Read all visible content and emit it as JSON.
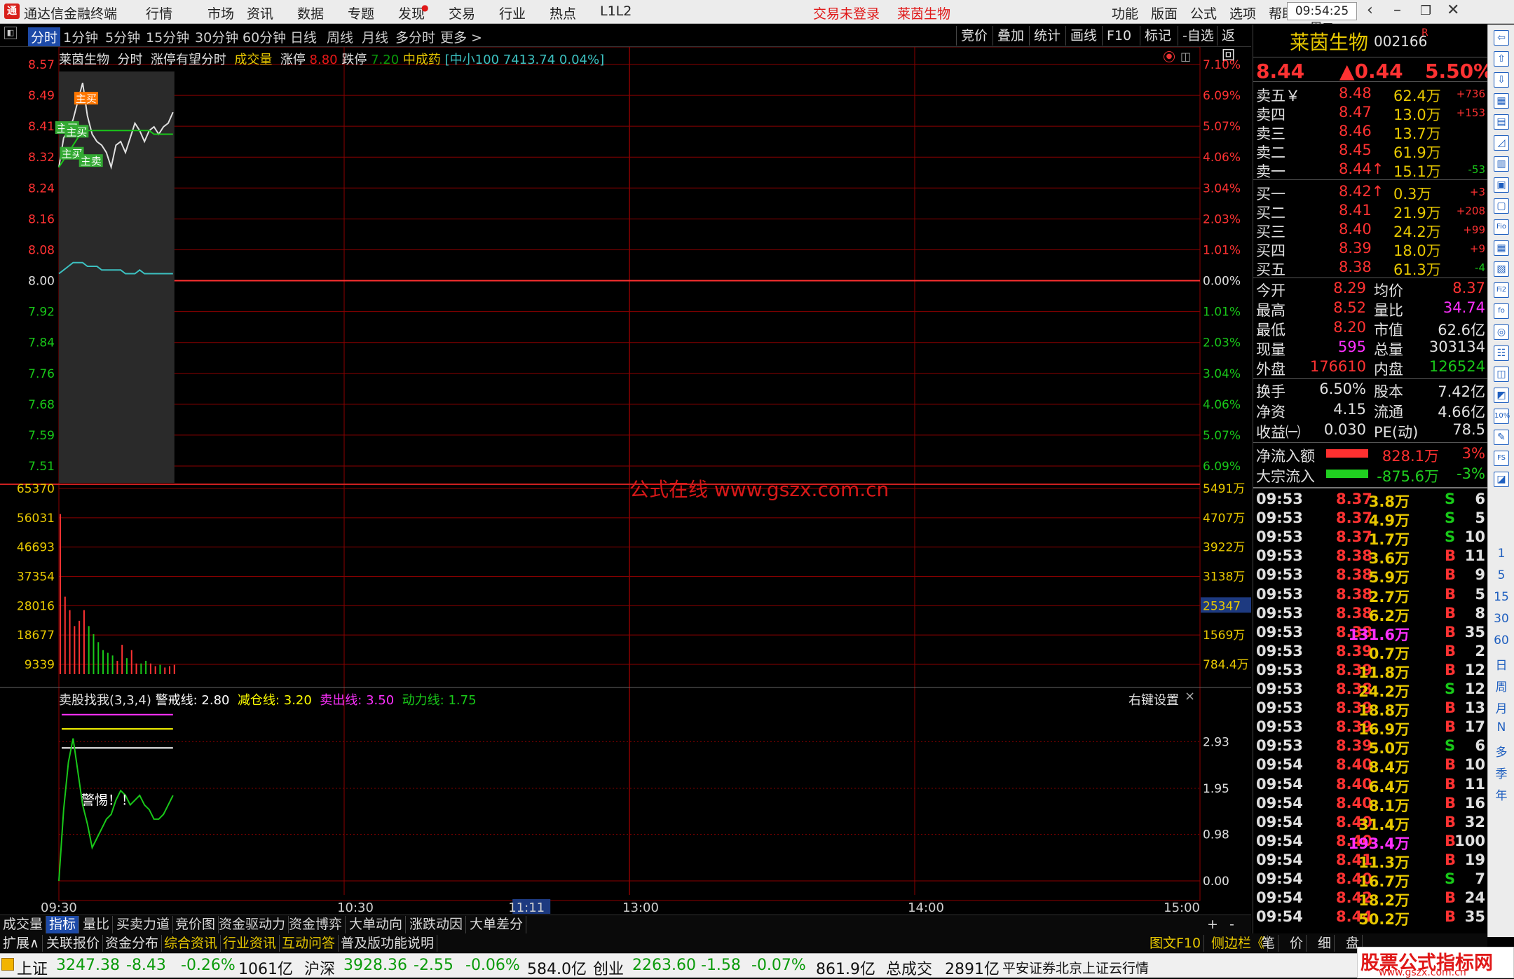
{
  "app": {
    "title": "通达信金融终端",
    "menu": [
      "行情",
      "市场",
      "资讯",
      "数据",
      "专题",
      "发现",
      "交易",
      "行业",
      "热点",
      "L1L2"
    ],
    "status_left": "交易未登录",
    "status_stock": "莱茵生物",
    "menu_right": [
      "功能",
      "版面",
      "公式",
      "选项",
      "帮助"
    ],
    "clock": "09:54:25",
    "weekday": "周二"
  },
  "periods": [
    "分时",
    "1分钟",
    "5分钟",
    "15分钟",
    "30分钟",
    "60分钟",
    "日线",
    "周线",
    "月线",
    "多分时",
    "更多 >"
  ],
  "active_period": "分时",
  "right_tools": [
    "竞价",
    "叠加",
    "统计",
    "画线",
    "F10",
    "标记",
    "-自选",
    "返回"
  ],
  "chart_header": {
    "name": "莱茵生物",
    "mode": "分时",
    "formula": "涨停有望分时",
    "vol_label": "成交量",
    "limit_up_label": "涨停",
    "limit_up": "8.80",
    "limit_down_label": "跌停",
    "limit_down": "7.20",
    "industry": "中成药",
    "index": "[中小100 7413.74 0.04%]"
  },
  "watermark": "公式在线  www.gszx.com.cn",
  "price_axis": {
    "left": [
      "8.57",
      "8.49",
      "8.41",
      "8.32",
      "8.24",
      "8.16",
      "8.08",
      "8.00",
      "7.92",
      "7.84",
      "7.76",
      "7.68",
      "7.59",
      "7.51"
    ],
    "right": [
      "7.10%",
      "6.09%",
      "5.07%",
      "4.06%",
      "3.04%",
      "2.03%",
      "1.01%",
      "0.00%",
      "1.01%",
      "2.03%",
      "3.04%",
      "4.06%",
      "5.07%",
      "6.09%"
    ]
  },
  "volume_axis": {
    "left": [
      "65370",
      "56031",
      "46693",
      "37354",
      "28016",
      "18677",
      "9339"
    ],
    "right": [
      "5491万",
      "4707万",
      "3922万",
      "3138万",
      "25347",
      "1569万",
      "784.4万"
    ]
  },
  "indicator": {
    "title": "卖股找我(3,3,4)",
    "l1_label": "警戒线:",
    "l1_value": "2.80",
    "l2_label": "减仓线:",
    "l2_value": "3.20",
    "l3_label": "卖出线:",
    "l3_value": "3.50",
    "l4_label": "动力线:",
    "l4_value": "1.75",
    "settings": "右键设置",
    "close": "×",
    "axis": [
      "2.93",
      "1.95",
      "0.98",
      "0.00"
    ],
    "alert": "警惕！！"
  },
  "time_axis": [
    "09:30",
    "10:30",
    "11:11",
    "13:00",
    "14:00",
    "15:00"
  ],
  "signal_labels": [
    "主买",
    "主买",
    "主买",
    "主买",
    "主卖"
  ],
  "chart_data": [
    {
      "type": "line",
      "title": "分时",
      "x": [
        "09:30",
        "09:31",
        "09:32",
        "09:33",
        "09:34",
        "09:35",
        "09:36",
        "09:37",
        "09:38",
        "09:39",
        "09:40",
        "09:41",
        "09:42",
        "09:43",
        "09:44",
        "09:45",
        "09:46",
        "09:47",
        "09:48",
        "09:49",
        "09:50",
        "09:51",
        "09:52",
        "09:53",
        "09:54"
      ],
      "series": [
        {
          "name": "价格",
          "values": [
            8.29,
            8.37,
            8.39,
            8.42,
            8.47,
            8.52,
            8.43,
            8.38,
            8.36,
            8.35,
            8.33,
            8.29,
            8.35,
            8.36,
            8.33,
            8.37,
            8.41,
            8.39,
            8.36,
            8.39,
            8.4,
            8.38,
            8.4,
            8.41,
            8.44
          ],
          "color": "#e0e0e0"
        },
        {
          "name": "均价",
          "values": [
            8.29,
            8.31,
            8.33,
            8.35,
            8.37,
            8.39,
            8.39,
            8.39,
            8.39,
            8.39,
            8.39,
            8.39,
            8.39,
            8.39,
            8.39,
            8.39,
            8.39,
            8.39,
            8.39,
            8.39,
            8.38,
            8.38,
            8.38,
            8.38,
            8.38
          ],
          "color": "#19c819"
        },
        {
          "name": "指数",
          "values": [
            8.0,
            8.01,
            8.02,
            8.03,
            8.03,
            8.03,
            8.02,
            8.02,
            8.02,
            8.01,
            8.01,
            8.01,
            8.01,
            8.01,
            8.0,
            8.0,
            8.0,
            8.01,
            8.0,
            8.0,
            8.0,
            8.0,
            8.0,
            8.0,
            8.0
          ],
          "color": "#3cc0c0"
        }
      ],
      "ylim": [
        7.43,
        8.57
      ],
      "prev_close": 8.0
    },
    {
      "type": "bar",
      "title": "成交量",
      "x": [
        "09:30",
        "09:31",
        "09:32",
        "09:33",
        "09:34",
        "09:35",
        "09:36",
        "09:37",
        "09:38",
        "09:39",
        "09:40",
        "09:41",
        "09:42",
        "09:43",
        "09:44",
        "09:45",
        "09:46",
        "09:47",
        "09:48",
        "09:49",
        "09:50",
        "09:51",
        "09:52",
        "09:53",
        "09:54"
      ],
      "values": [
        60000,
        29000,
        24000,
        18000,
        20000,
        24000,
        18000,
        15000,
        12000,
        9000,
        8000,
        7000,
        5000,
        11000,
        6000,
        9000,
        4000,
        4000,
        5000,
        4000,
        3000,
        3500,
        2500,
        3000,
        3500
      ],
      "ylim": [
        0,
        65370
      ]
    },
    {
      "type": "line",
      "title": "卖股找我(3,3,4)",
      "x": [
        "09:30",
        "09:31",
        "09:32",
        "09:33",
        "09:34",
        "09:35",
        "09:36",
        "09:37",
        "09:38",
        "09:39",
        "09:40",
        "09:41",
        "09:42",
        "09:43",
        "09:44",
        "09:45",
        "09:46",
        "09:47",
        "09:48",
        "09:49",
        "09:50",
        "09:51",
        "09:52",
        "09:53",
        "09:54"
      ],
      "series": [
        {
          "name": "指标",
          "values": [
            0.0,
            1.5,
            2.5,
            3.0,
            2.3,
            1.6,
            1.2,
            0.7,
            0.9,
            1.1,
            1.3,
            1.4,
            1.7,
            1.9,
            1.8,
            1.6,
            1.7,
            1.8,
            1.6,
            1.5,
            1.3,
            1.3,
            1.4,
            1.6,
            1.8
          ],
          "color": "#19c819"
        }
      ],
      "thresholds": [
        {
          "name": "警戒线",
          "value": 2.8,
          "color": "#ffffff"
        },
        {
          "name": "减仓线",
          "value": 3.2,
          "color": "#ffff00"
        },
        {
          "name": "卖出线",
          "value": 3.5,
          "color": "#ff30ff"
        }
      ],
      "ylim": [
        0,
        3.6
      ]
    }
  ],
  "quote": {
    "name": "莱茵生物",
    "code": "002166",
    "tag": "R",
    "price": "8.44",
    "change": "▲0.44",
    "pct": "5.50%",
    "asks": [
      {
        "label": "卖五￥",
        "price": "8.48",
        "vol": "62.4万",
        "chg": "+736"
      },
      {
        "label": "卖四",
        "price": "8.47",
        "vol": "13.0万",
        "chg": "+153"
      },
      {
        "label": "卖三",
        "price": "8.46",
        "vol": "13.7万",
        "chg": ""
      },
      {
        "label": "卖二",
        "price": "8.45",
        "vol": "61.9万",
        "chg": ""
      },
      {
        "label": "卖一",
        "price": "8.44↑",
        "vol": "15.1万",
        "chg": "-53"
      }
    ],
    "bids": [
      {
        "label": "买一",
        "price": "8.42↑",
        "vol": "0.3万",
        "chg": "+3"
      },
      {
        "label": "买二",
        "price": "8.41",
        "vol": "21.9万",
        "chg": "+208"
      },
      {
        "label": "买三",
        "price": "8.40",
        "vol": "24.2万",
        "chg": "+99"
      },
      {
        "label": "买四",
        "price": "8.39",
        "vol": "18.0万",
        "chg": "+9"
      },
      {
        "label": "买五",
        "price": "8.38",
        "vol": "61.3万",
        "chg": "-4"
      }
    ],
    "stats": [
      {
        "l1": "今开",
        "v1": "8.29",
        "l2": "均价",
        "v2": "8.37"
      },
      {
        "l1": "最高",
        "v1": "8.52",
        "l2": "量比",
        "v2": "34.74"
      },
      {
        "l1": "最低",
        "v1": "8.20",
        "l2": "市值",
        "v2": "62.6亿"
      },
      {
        "l1": "现量",
        "v1": "595",
        "l2": "总量",
        "v2": "303134"
      },
      {
        "l1": "外盘",
        "v1": "176610",
        "l2": "内盘",
        "v2": "126524"
      }
    ],
    "stats2": [
      {
        "l1": "换手",
        "v1": "6.50%",
        "l2": "股本",
        "v2": "7.42亿"
      },
      {
        "l1": "净资",
        "v1": "4.15",
        "l2": "流通",
        "v2": "4.66亿"
      },
      {
        "l1": "收益㈠",
        "v1": "0.030",
        "l2": "PE(动)",
        "v2": "78.5"
      }
    ],
    "flows": [
      {
        "label": "净流入额",
        "value": "828.1万",
        "pct": "3%",
        "fill": 0.6,
        "color": "#ff3030"
      },
      {
        "label": "大宗流入",
        "value": "-875.6万",
        "pct": "-3%",
        "fill": 0.6,
        "color": "#20d020"
      }
    ]
  },
  "ticks": [
    {
      "t": "09:53",
      "p": "8.37",
      "v": "3.8万",
      "d": "S",
      "n": "6"
    },
    {
      "t": "09:53",
      "p": "8.37",
      "v": "4.9万",
      "d": "S",
      "n": "5"
    },
    {
      "t": "09:53",
      "p": "8.37",
      "v": "1.7万",
      "d": "S",
      "n": "10"
    },
    {
      "t": "09:53",
      "p": "8.38",
      "v": "3.6万",
      "d": "B",
      "n": "11"
    },
    {
      "t": "09:53",
      "p": "8.38",
      "v": "5.9万",
      "d": "B",
      "n": "9"
    },
    {
      "t": "09:53",
      "p": "8.38",
      "v": "2.7万",
      "d": "B",
      "n": "5"
    },
    {
      "t": "09:53",
      "p": "8.38",
      "v": "6.2万",
      "d": "B",
      "n": "8"
    },
    {
      "t": "09:53",
      "p": "8.38",
      "v": "131.6万",
      "d": "B",
      "n": "35"
    },
    {
      "t": "09:53",
      "p": "8.39",
      "v": "0.7万",
      "d": "B",
      "n": "2"
    },
    {
      "t": "09:53",
      "p": "8.39",
      "v": "11.8万",
      "d": "B",
      "n": "12"
    },
    {
      "t": "09:53",
      "p": "8.38",
      "v": "24.2万",
      "d": "S",
      "n": "12"
    },
    {
      "t": "09:53",
      "p": "8.39",
      "v": "18.8万",
      "d": "B",
      "n": "13"
    },
    {
      "t": "09:53",
      "p": "8.39",
      "v": "16.9万",
      "d": "B",
      "n": "17"
    },
    {
      "t": "09:53",
      "p": "8.39",
      "v": "5.0万",
      "d": "S",
      "n": "6"
    },
    {
      "t": "09:54",
      "p": "8.40",
      "v": "8.4万",
      "d": "B",
      "n": "10"
    },
    {
      "t": "09:54",
      "p": "8.40",
      "v": "6.4万",
      "d": "B",
      "n": "11"
    },
    {
      "t": "09:54",
      "p": "8.40",
      "v": "8.1万",
      "d": "B",
      "n": "16"
    },
    {
      "t": "09:54",
      "p": "8.40",
      "v": "31.4万",
      "d": "B",
      "n": "32"
    },
    {
      "t": "09:54",
      "p": "8.40",
      "v": "193.4万",
      "d": "B",
      "n": "100"
    },
    {
      "t": "09:54",
      "p": "8.41",
      "v": "11.3万",
      "d": "B",
      "n": "19"
    },
    {
      "t": "09:54",
      "p": "8.40",
      "v": "16.7万",
      "d": "S",
      "n": "7"
    },
    {
      "t": "09:54",
      "p": "8.42",
      "v": "18.2万",
      "d": "B",
      "n": "24"
    },
    {
      "t": "09:54",
      "p": "8.44",
      "v": "50.2万",
      "d": "B",
      "n": "35"
    }
  ],
  "tabs_row1": [
    "成交量",
    "指标",
    "量比",
    "买卖力道",
    "竞价图",
    "资金驱动力",
    "资金博弈",
    "大单动向",
    "涨跌动因",
    "大单差分"
  ],
  "tabs_row1_active": "指标",
  "tabs_row1_right": [
    "+",
    "-"
  ],
  "tabs_row2": [
    "扩展∧",
    "关联报价",
    "资金分布",
    "综合资讯",
    "行业资讯",
    "互动问答",
    "普及版功能说明"
  ],
  "tabs_row2_right": [
    "图文F10",
    "侧边栏《",
    "笔",
    "价",
    "细",
    "盘"
  ],
  "side_icons": [
    "1",
    "5",
    "15",
    "30",
    "60",
    "日",
    "周",
    "月",
    "N",
    "多",
    "季",
    "年"
  ],
  "status": {
    "sh_label": "上证",
    "sh": "3247.38",
    "sh_chg": "-8.43",
    "sh_pct": "-0.26%",
    "sh_amt": "1061亿",
    "hs_label": "沪深",
    "hs": "3928.36",
    "hs_chg": "-2.55",
    "hs_pct": "-0.06%",
    "hs_amt": "584.0亿",
    "cy_label": "创业",
    "cy": "2263.60",
    "cy_chg": "-1.58",
    "cy_pct": "-0.07%",
    "cy_amt": "861.9亿",
    "total_label": "总成交",
    "total": "2891亿",
    "broker": "平安证券北京上证云行情",
    "brand": "股票公式指标网",
    "brand_url": "www.gszx.com.cn"
  },
  "colors": {
    "up": "#ff3232",
    "down": "#19c819",
    "grid": "#8b0000",
    "bg": "#000000",
    "accent": "#1d4aa8"
  }
}
